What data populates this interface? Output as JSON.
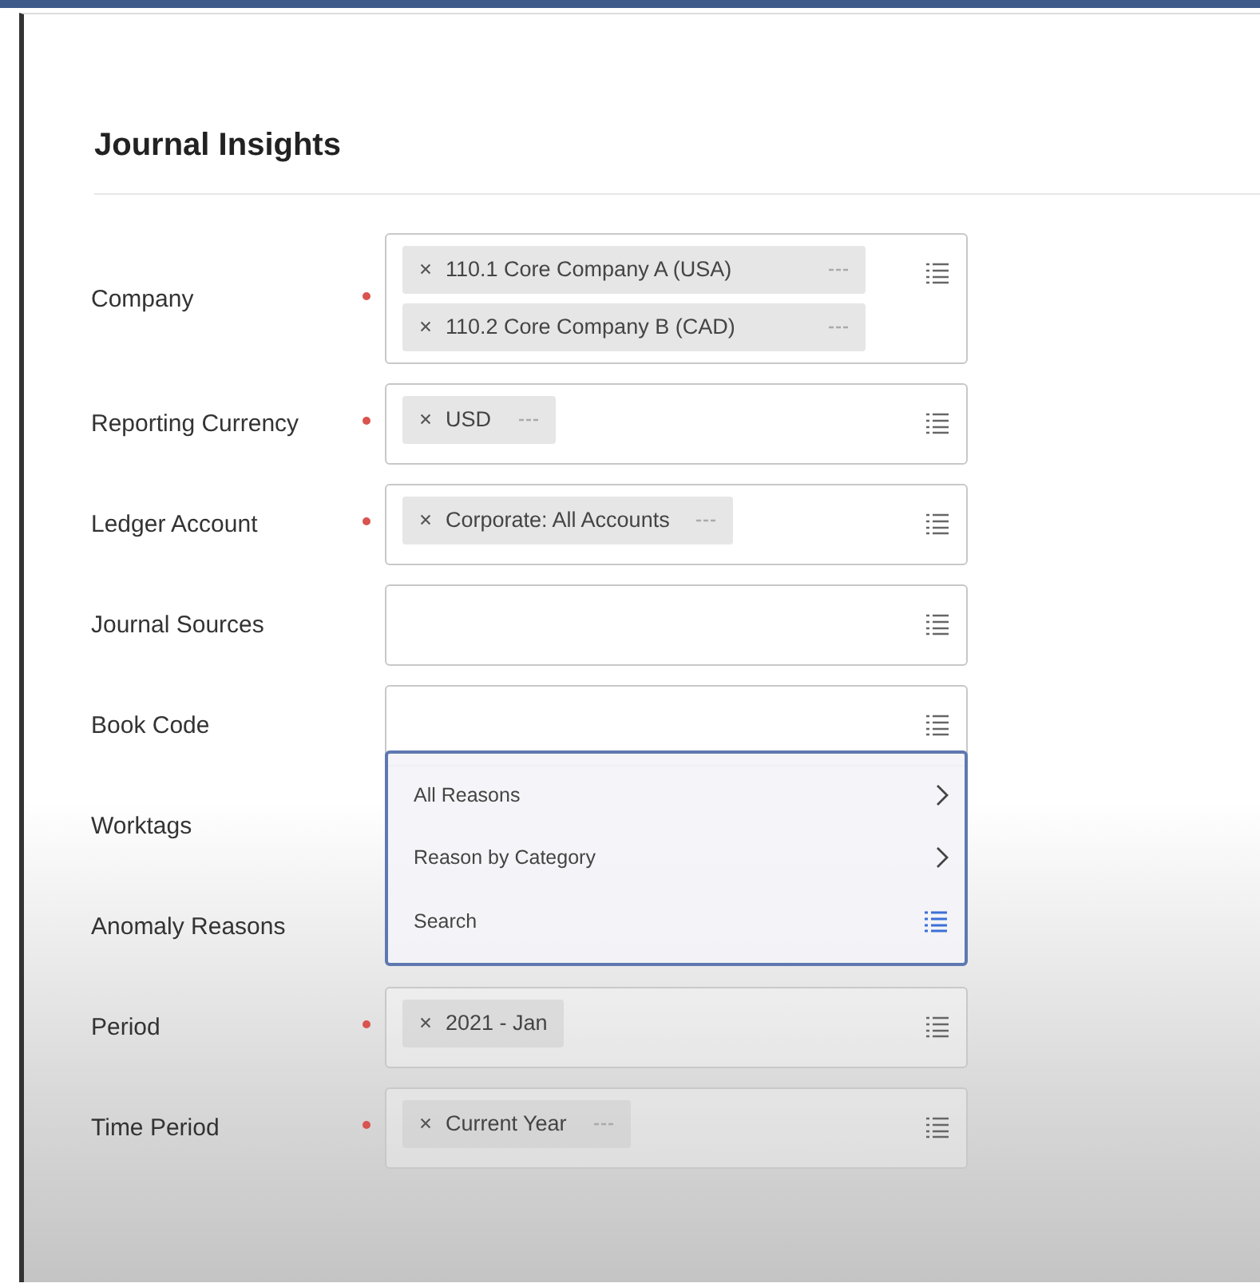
{
  "title": "Journal Insights",
  "fields": [
    {
      "label": "Company",
      "required": true,
      "kind": "chips",
      "chips": [
        {
          "text": "110.1 Core Company A (USA)",
          "more": true
        },
        {
          "text": "110.2 Core Company B (CAD)",
          "more": true
        }
      ]
    },
    {
      "label": "Reporting Currency",
      "required": true,
      "kind": "chips",
      "chips": [
        {
          "text": "USD",
          "more": true
        }
      ]
    },
    {
      "label": "Ledger Account",
      "required": true,
      "kind": "chips",
      "chips": [
        {
          "text": "Corporate: All Accounts",
          "more": true
        }
      ]
    },
    {
      "label": "Journal Sources",
      "required": false,
      "kind": "chips"
    },
    {
      "label": "Book Code",
      "required": false,
      "kind": "chips"
    },
    {
      "label": "Worktags",
      "required": false,
      "kind": "covered"
    },
    {
      "label": "Anomaly Reasons",
      "required": false,
      "kind": "covered"
    },
    {
      "label": "Period",
      "required": true,
      "kind": "chips",
      "chips": [
        {
          "text": "2021 - Jan",
          "more": false
        }
      ]
    },
    {
      "label": "Time Period",
      "required": true,
      "kind": "chips",
      "chips": [
        {
          "text": "Current Year",
          "more": true
        }
      ]
    }
  ],
  "dropdown": {
    "items": [
      {
        "label": "All Reasons",
        "kind": "submenu"
      },
      {
        "label": "Reason by Category",
        "kind": "submenu"
      },
      {
        "label": "Search",
        "kind": "search"
      }
    ]
  }
}
